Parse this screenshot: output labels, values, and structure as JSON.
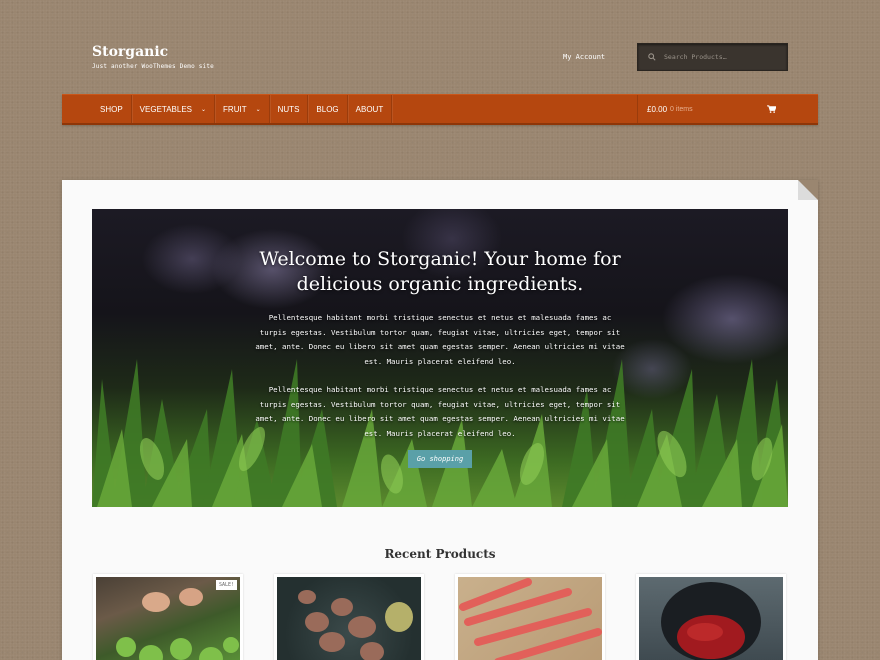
{
  "site": {
    "title": "Storganic",
    "tagline": "Just another WooThemes Demo site"
  },
  "header": {
    "my_account": "My Account",
    "search_placeholder": "Search Products…"
  },
  "nav": {
    "items": [
      {
        "label": "SHOP",
        "dropdown": false
      },
      {
        "label": "VEGETABLES",
        "dropdown": true
      },
      {
        "label": "FRUIT",
        "dropdown": true
      },
      {
        "label": "NUTS",
        "dropdown": false
      },
      {
        "label": "BLOG",
        "dropdown": false
      },
      {
        "label": "ABOUT",
        "dropdown": false
      }
    ],
    "cart_total": "£0.00",
    "cart_items": "0 items"
  },
  "hero": {
    "heading": "Welcome to Storganic! Your home for delicious organic ingredients.",
    "paragraph_1": "Pellentesque habitant morbi tristique senectus et netus et malesuada fames ac turpis egestas. Vestibulum tortor quam, feugiat vitae, ultricies eget, tempor sit amet, ante. Donec eu libero sit amet quam egestas semper. Aenean ultricies mi vitae est. Mauris placerat eleifend leo.",
    "paragraph_2": "Pellentesque habitant morbi tristique senectus et netus et malesuada fames ac turpis egestas. Vestibulum tortor quam, feugiat vitae, ultricies eget, tempor sit amet, ante. Donec eu libero sit amet quam egestas semper. Aenean ultricies mi vitae est. Mauris placerat eleifend leo.",
    "button": "Go shopping"
  },
  "recent": {
    "title": "Recent Products",
    "sale_badge": "SALE!"
  },
  "colors": {
    "nav_bg": "#b5470f",
    "button_bg": "#5aa0a8",
    "page_bg": "#9a8670"
  }
}
